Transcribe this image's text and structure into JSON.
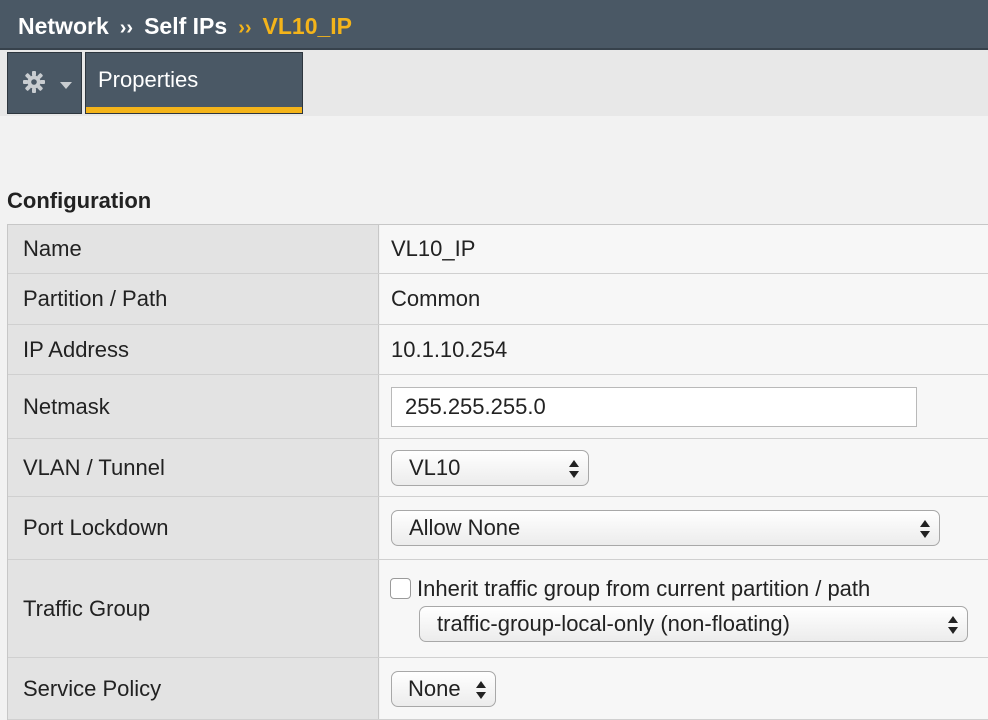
{
  "breadcrumb": {
    "items": [
      "Network",
      "Self IPs"
    ],
    "current": "VL10_IP",
    "separator": "››"
  },
  "toolbar": {
    "gear_icon": "gear-icon",
    "tab_label": "Properties"
  },
  "section": {
    "title": "Configuration"
  },
  "config": {
    "name": {
      "label": "Name",
      "value": "VL10_IP"
    },
    "partition": {
      "label": "Partition / Path",
      "value": "Common"
    },
    "ip": {
      "label": "IP Address",
      "value": "10.1.10.254"
    },
    "netmask": {
      "label": "Netmask",
      "value": "255.255.255.0"
    },
    "vlan": {
      "label": "VLAN / Tunnel",
      "selected": "VL10"
    },
    "port_lockdown": {
      "label": "Port Lockdown",
      "selected": "Allow None"
    },
    "traffic_group": {
      "label": "Traffic Group",
      "inherit_label": "Inherit traffic group from current partition / path",
      "inherit_checked": false,
      "selected": "traffic-group-local-only (non-floating)"
    },
    "service_policy": {
      "label": "Service Policy",
      "selected": "None"
    }
  },
  "colors": {
    "header_bg": "#4a5865",
    "accent": "#f4b41a"
  }
}
